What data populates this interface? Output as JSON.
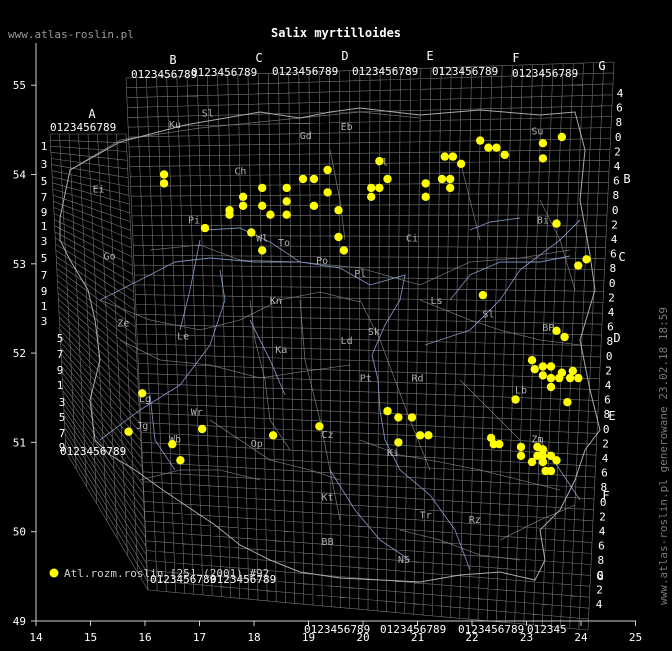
{
  "header": {
    "site": "www.atlas-roslin.pl",
    "title": "Salix myrtilloides"
  },
  "side_note": "www.atlas-roslin.pl generowane 23.02.18 18:59",
  "legend": {
    "label": "Atl.rozm.roslin [25] (2001) #92",
    "marker_color": "#ffff00"
  },
  "colors": {
    "background": "#000000",
    "grid": "#8a8a8a",
    "border": "#bdbdbd",
    "rivers": "#8fa6d8",
    "regions": "#9a9a9a",
    "labels": "#cfcfcf",
    "points": "#ffff00"
  },
  "axes": {
    "x_ticks": [
      "14",
      "15",
      "16",
      "17",
      "18",
      "19",
      "20",
      "21",
      "22",
      "23",
      "24",
      "25"
    ],
    "y_ticks": [
      "49",
      "50",
      "51",
      "52",
      "53",
      "54",
      "55"
    ]
  },
  "grid_letters_top": [
    "A",
    "B",
    "C",
    "D",
    "E",
    "F",
    "G"
  ],
  "grid_letters_right": [
    "B",
    "C",
    "D",
    "E",
    "F",
    "G"
  ],
  "digit_strip": "0123456789",
  "right_digits": [
    "4",
    "6",
    "8",
    "0",
    "2",
    "4",
    "6",
    "8",
    "0",
    "2",
    "4",
    "6",
    "8",
    "0",
    "2",
    "4",
    "6",
    "8",
    "0",
    "2",
    "4",
    "6",
    "8",
    "0",
    "2",
    "4",
    "6",
    "8",
    "0",
    "2",
    "4",
    "6",
    "8",
    "0",
    "2",
    "4",
    "6",
    "8",
    "0",
    "2",
    "4",
    "6",
    "8",
    "0"
  ],
  "left_digits": [
    "1",
    "3",
    "5",
    "7",
    "9",
    "1",
    "3",
    "5",
    "7",
    "9",
    "1",
    "3",
    "5",
    "7",
    "9",
    "1",
    "3",
    "5",
    "7",
    "9",
    "1",
    "3",
    "5",
    "7",
    "9",
    "1",
    "3",
    "5",
    "7",
    "9",
    "1",
    "3",
    "5",
    "7",
    "9"
  ],
  "region_labels": [
    {
      "text": "Ku",
      "lon": 16.55,
      "lat": 54.52
    },
    {
      "text": "Sl",
      "lon": 17.15,
      "lat": 54.65
    },
    {
      "text": "Gd",
      "lon": 18.95,
      "lat": 54.4
    },
    {
      "text": "Eb",
      "lon": 19.7,
      "lat": 54.5
    },
    {
      "text": "Ol",
      "lon": 20.35,
      "lat": 54.1
    },
    {
      "text": "Su",
      "lon": 23.2,
      "lat": 54.45
    },
    {
      "text": "Ch",
      "lon": 17.75,
      "lat": 54.0
    },
    {
      "text": "Pi",
      "lon": 16.9,
      "lat": 53.45
    },
    {
      "text": "Ei",
      "lon": 15.15,
      "lat": 53.8
    },
    {
      "text": "Ci",
      "lon": 20.9,
      "lat": 53.25
    },
    {
      "text": "Bi",
      "lon": 23.3,
      "lat": 53.45
    },
    {
      "text": "Wl",
      "lon": 18.15,
      "lat": 53.25
    },
    {
      "text": "To",
      "lon": 18.55,
      "lat": 53.2
    },
    {
      "text": "Go",
      "lon": 15.35,
      "lat": 53.05
    },
    {
      "text": "Po",
      "lon": 19.25,
      "lat": 53.0
    },
    {
      "text": "Pl",
      "lon": 19.95,
      "lat": 52.85
    },
    {
      "text": "Kn",
      "lon": 18.4,
      "lat": 52.55
    },
    {
      "text": "Ls",
      "lon": 21.35,
      "lat": 52.55
    },
    {
      "text": "Sl",
      "lon": 22.3,
      "lat": 52.4
    },
    {
      "text": "Ze",
      "lon": 15.6,
      "lat": 52.3
    },
    {
      "text": "Le",
      "lon": 16.7,
      "lat": 52.15
    },
    {
      "text": "Sk",
      "lon": 20.2,
      "lat": 52.2
    },
    {
      "text": "Ld",
      "lon": 19.7,
      "lat": 52.1
    },
    {
      "text": "Ka",
      "lon": 18.5,
      "lat": 52.0
    },
    {
      "text": "BP",
      "lon": 23.4,
      "lat": 52.25
    },
    {
      "text": "Pt",
      "lon": 20.05,
      "lat": 51.68
    },
    {
      "text": "Rd",
      "lon": 21.0,
      "lat": 51.68
    },
    {
      "text": "Lb",
      "lon": 22.9,
      "lat": 51.55
    },
    {
      "text": "Lg",
      "lon": 16.0,
      "lat": 51.45
    },
    {
      "text": "Wr",
      "lon": 16.95,
      "lat": 51.3
    },
    {
      "text": "Op",
      "lon": 18.05,
      "lat": 50.95
    },
    {
      "text": "Cz",
      "lon": 19.35,
      "lat": 51.05
    },
    {
      "text": "Jg",
      "lon": 15.95,
      "lat": 51.15
    },
    {
      "text": "Wb",
      "lon": 16.55,
      "lat": 51.0
    },
    {
      "text": "Zm",
      "lon": 23.2,
      "lat": 51.0
    },
    {
      "text": "Ki",
      "lon": 20.55,
      "lat": 50.85
    },
    {
      "text": "Kt",
      "lon": 19.35,
      "lat": 50.35
    },
    {
      "text": "Tr",
      "lon": 21.15,
      "lat": 50.15
    },
    {
      "text": "Rz",
      "lon": 22.05,
      "lat": 50.1
    },
    {
      "text": "BB",
      "lon": 19.35,
      "lat": 49.85
    },
    {
      "text": "NS",
      "lon": 20.75,
      "lat": 49.65
    }
  ],
  "points": [
    {
      "lon": 16.35,
      "lat": 54.0
    },
    {
      "lon": 16.35,
      "lat": 53.9
    },
    {
      "lon": 17.1,
      "lat": 53.4
    },
    {
      "lon": 17.55,
      "lat": 53.55
    },
    {
      "lon": 17.55,
      "lat": 53.6
    },
    {
      "lon": 17.8,
      "lat": 53.75
    },
    {
      "lon": 17.8,
      "lat": 53.65
    },
    {
      "lon": 17.95,
      "lat": 53.35
    },
    {
      "lon": 18.15,
      "lat": 53.85
    },
    {
      "lon": 18.15,
      "lat": 53.65
    },
    {
      "lon": 18.15,
      "lat": 53.15
    },
    {
      "lon": 18.3,
      "lat": 53.55
    },
    {
      "lon": 18.6,
      "lat": 53.85
    },
    {
      "lon": 18.6,
      "lat": 53.7
    },
    {
      "lon": 18.6,
      "lat": 53.55
    },
    {
      "lon": 18.9,
      "lat": 53.95
    },
    {
      "lon": 19.1,
      "lat": 53.95
    },
    {
      "lon": 19.1,
      "lat": 53.65
    },
    {
      "lon": 19.35,
      "lat": 54.05
    },
    {
      "lon": 19.35,
      "lat": 53.8
    },
    {
      "lon": 19.55,
      "lat": 53.6
    },
    {
      "lon": 19.55,
      "lat": 53.3
    },
    {
      "lon": 19.65,
      "lat": 53.15
    },
    {
      "lon": 20.15,
      "lat": 53.85
    },
    {
      "lon": 20.15,
      "lat": 53.75
    },
    {
      "lon": 20.3,
      "lat": 54.15
    },
    {
      "lon": 20.3,
      "lat": 53.85
    },
    {
      "lon": 20.45,
      "lat": 53.95
    },
    {
      "lon": 21.15,
      "lat": 53.9
    },
    {
      "lon": 21.15,
      "lat": 53.75
    },
    {
      "lon": 21.5,
      "lat": 54.2
    },
    {
      "lon": 21.45,
      "lat": 53.95
    },
    {
      "lon": 21.65,
      "lat": 54.2
    },
    {
      "lon": 21.6,
      "lat": 53.95
    },
    {
      "lon": 21.6,
      "lat": 53.85
    },
    {
      "lon": 21.8,
      "lat": 54.12
    },
    {
      "lon": 22.15,
      "lat": 54.38
    },
    {
      "lon": 22.3,
      "lat": 54.3
    },
    {
      "lon": 22.45,
      "lat": 54.3
    },
    {
      "lon": 22.6,
      "lat": 54.22
    },
    {
      "lon": 23.3,
      "lat": 54.35
    },
    {
      "lon": 23.3,
      "lat": 54.18
    },
    {
      "lon": 23.65,
      "lat": 54.42
    },
    {
      "lon": 23.55,
      "lat": 53.45
    },
    {
      "lon": 23.95,
      "lat": 52.98
    },
    {
      "lon": 24.1,
      "lat": 53.05
    },
    {
      "lon": 22.2,
      "lat": 52.65
    },
    {
      "lon": 23.55,
      "lat": 52.25
    },
    {
      "lon": 23.7,
      "lat": 52.18
    },
    {
      "lon": 23.1,
      "lat": 51.92
    },
    {
      "lon": 23.15,
      "lat": 51.82
    },
    {
      "lon": 23.3,
      "lat": 51.85
    },
    {
      "lon": 23.3,
      "lat": 51.75
    },
    {
      "lon": 23.45,
      "lat": 51.85
    },
    {
      "lon": 23.45,
      "lat": 51.72
    },
    {
      "lon": 23.45,
      "lat": 51.62
    },
    {
      "lon": 23.6,
      "lat": 51.72
    },
    {
      "lon": 23.65,
      "lat": 51.78
    },
    {
      "lon": 23.8,
      "lat": 51.72
    },
    {
      "lon": 23.85,
      "lat": 51.8
    },
    {
      "lon": 23.95,
      "lat": 51.72
    },
    {
      "lon": 23.75,
      "lat": 51.45
    },
    {
      "lon": 22.8,
      "lat": 51.48
    },
    {
      "lon": 15.95,
      "lat": 51.55
    },
    {
      "lon": 15.7,
      "lat": 51.12
    },
    {
      "lon": 16.5,
      "lat": 50.98
    },
    {
      "lon": 16.65,
      "lat": 50.8
    },
    {
      "lon": 17.05,
      "lat": 51.15
    },
    {
      "lon": 18.35,
      "lat": 51.08
    },
    {
      "lon": 19.2,
      "lat": 51.18
    },
    {
      "lon": 20.45,
      "lat": 51.35
    },
    {
      "lon": 20.65,
      "lat": 51.28
    },
    {
      "lon": 20.65,
      "lat": 51.0
    },
    {
      "lon": 20.9,
      "lat": 51.28
    },
    {
      "lon": 21.05,
      "lat": 51.08
    },
    {
      "lon": 21.2,
      "lat": 51.08
    },
    {
      "lon": 22.35,
      "lat": 51.05
    },
    {
      "lon": 22.4,
      "lat": 50.98
    },
    {
      "lon": 22.5,
      "lat": 50.98
    },
    {
      "lon": 22.9,
      "lat": 50.95
    },
    {
      "lon": 22.9,
      "lat": 50.85
    },
    {
      "lon": 23.1,
      "lat": 50.78
    },
    {
      "lon": 23.2,
      "lat": 50.95
    },
    {
      "lon": 23.2,
      "lat": 50.85
    },
    {
      "lon": 23.3,
      "lat": 50.92
    },
    {
      "lon": 23.3,
      "lat": 50.78
    },
    {
      "lon": 23.35,
      "lat": 50.68
    },
    {
      "lon": 23.45,
      "lat": 50.68
    },
    {
      "lon": 23.45,
      "lat": 50.85
    },
    {
      "lon": 23.55,
      "lat": 50.8
    },
    {
      "lon": 23.3,
      "lat": 50.85
    }
  ]
}
